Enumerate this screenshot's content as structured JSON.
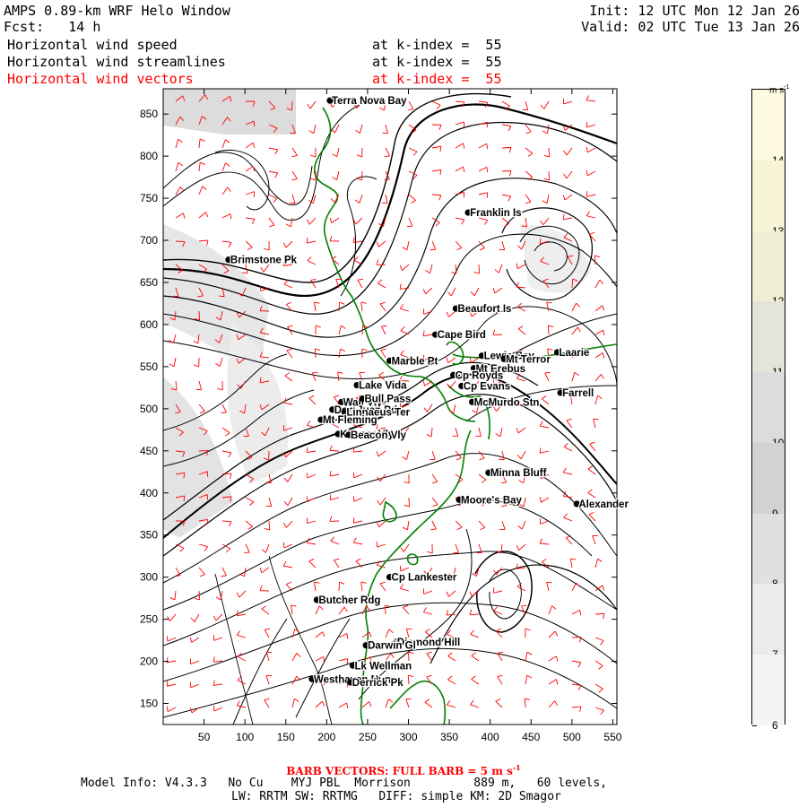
{
  "header": {
    "title": "AMPS 0.89-km WRF Helo Window",
    "init": "Init: 12 UTC Mon 12 Jan 26",
    "fcst": "Fcst:   14 h",
    "valid": "Valid: 02 UTC Tue 13 Jan 26",
    "lines": [
      {
        "label": "Horizontal wind speed",
        "kindex": "at k-index =  55"
      },
      {
        "label": "Horizontal wind streamlines",
        "kindex": "at k-index =  55"
      },
      {
        "label": "Horizontal wind vectors",
        "kindex": "at k-index =  55"
      }
    ]
  },
  "footer": {
    "barb": "BARB VECTORS:  FULL BARB = 5 m s",
    "barb_exp": "-1",
    "model_info": "Model Info: V4.3.3   No Cu    MYJ PBL  Morrison         889 m,   60 levels,",
    "physics": "LW: RRTM SW: RRTMG   DIFF: simple KM: 2D Smagor"
  },
  "colorbar": {
    "unit": "m s",
    "unit_exp": "-1",
    "levels": [
      {
        "value": "14",
        "color": "#fffbe0"
      },
      {
        "value": "13",
        "color": "#f6f3d6"
      },
      {
        "value": "12",
        "color": "#eeeed3"
      },
      {
        "value": "11",
        "color": "#e4e4d8"
      },
      {
        "value": "10",
        "color": "#dcdcdc"
      },
      {
        "value": "9",
        "color": "#d2d2d2"
      },
      {
        "value": "8",
        "color": "#e0e0e0"
      },
      {
        "value": "7",
        "color": "#ebebeb"
      },
      {
        "value": "6",
        "color": "#f4f4f4"
      }
    ]
  },
  "chart_data": {
    "type": "map",
    "xlim": [
      0,
      555
    ],
    "ylim": [
      125,
      880
    ],
    "xticks": [
      "50",
      "100",
      "150",
      "200",
      "250",
      "300",
      "350",
      "400",
      "450",
      "500",
      "550"
    ],
    "yticks": [
      "150",
      "200",
      "250",
      "300",
      "350",
      "400",
      "450",
      "500",
      "550",
      "600",
      "650",
      "700",
      "750",
      "800",
      "850"
    ],
    "stations": [
      {
        "name": "Terra Nova Bay",
        "x": 204,
        "y": 866
      },
      {
        "name": "Franklin Is",
        "x": 373,
        "y": 733
      },
      {
        "name": "Brimstone Pk",
        "x": 80,
        "y": 677
      },
      {
        "name": "Beaufort Is",
        "x": 358,
        "y": 619
      },
      {
        "name": "Cape Bird",
        "x": 333,
        "y": 588
      },
      {
        "name": "Lewis Bay",
        "x": 390,
        "y": 563
      },
      {
        "name": "Laarie",
        "x": 482,
        "y": 567
      },
      {
        "name": "Marble Pt",
        "x": 277,
        "y": 557
      },
      {
        "name": "Mt Terror",
        "x": 417,
        "y": 559
      },
      {
        "name": "Mt Erebus",
        "x": 380,
        "y": 548
      },
      {
        "name": "Cp Royds",
        "x": 355,
        "y": 540
      },
      {
        "name": "Lake Vida",
        "x": 237,
        "y": 528
      },
      {
        "name": "Cp Evans",
        "x": 365,
        "y": 527
      },
      {
        "name": "Farrell",
        "x": 486,
        "y": 519
      },
      {
        "name": "Wall Vly",
        "x": 218,
        "y": 508
      },
      {
        "name": "Bull Pass",
        "x": 244,
        "y": 512
      },
      {
        "name": "McMurdo Stn",
        "x": 378,
        "y": 508
      },
      {
        "name": "Don Juan Pd",
        "x": 207,
        "y": 499
      },
      {
        "name": "Linnaeus Ter",
        "x": 222,
        "y": 496
      },
      {
        "name": "Mt Fleming",
        "x": 193,
        "y": 487
      },
      {
        "name": "Kennar Vly",
        "x": 214,
        "y": 470
      },
      {
        "name": "Beacon Vly",
        "x": 227,
        "y": 469
      },
      {
        "name": "Minna Bluff",
        "x": 398,
        "y": 424
      },
      {
        "name": "Moore's Bay",
        "x": 362,
        "y": 392
      },
      {
        "name": "Alexander",
        "x": 506,
        "y": 387
      },
      {
        "name": "Cp Lankester",
        "x": 277,
        "y": 300
      },
      {
        "name": "Butcher Rdg",
        "x": 188,
        "y": 273
      },
      {
        "name": "Diamond Hill",
        "x": 284,
        "y": 223
      },
      {
        "name": "Darwin Gl",
        "x": 248,
        "y": 219
      },
      {
        "name": "Lk Wellman",
        "x": 232,
        "y": 195
      },
      {
        "name": "Westhaven Nun",
        "x": 182,
        "y": 179
      },
      {
        "name": "Derrick Pk",
        "x": 229,
        "y": 175
      }
    ]
  }
}
